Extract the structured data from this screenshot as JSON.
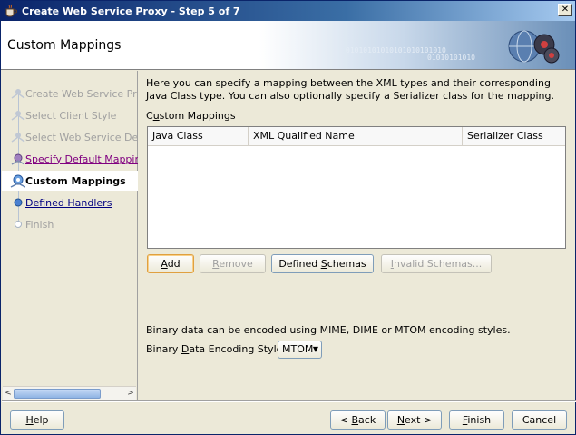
{
  "window": {
    "title": "Create Web Service Proxy - Step 5 of 7",
    "close_glyph": "✕"
  },
  "banner": {
    "title": "Custom Mappings",
    "binary_line1": "01010101010101010101010",
    "binary_line2": "01010101010"
  },
  "nav": {
    "items": [
      {
        "label": "Create Web Service Proxy",
        "state": "disabled",
        "icon": "step-done-icon"
      },
      {
        "label": "Select Client Style",
        "state": "disabled",
        "icon": "step-done-icon"
      },
      {
        "label": "Select Web Service Description",
        "state": "disabled",
        "icon": "step-done-icon"
      },
      {
        "label": "Specify Default Mapping Options",
        "state": "visited",
        "icon": "step-visited-icon"
      },
      {
        "label": "Custom Mappings",
        "state": "current",
        "icon": "step-current-icon"
      },
      {
        "label": "Defined Handlers",
        "state": "link",
        "icon": "step-next-icon"
      },
      {
        "label": "Finish",
        "state": "disabled",
        "icon": "step-pending-icon"
      }
    ],
    "scroll_left": "<",
    "scroll_right": ">"
  },
  "content": {
    "intro": "Here you can specify a mapping between the XML types and their corresponding Java Class type. You can also optionally specify a Serializer class for the mapping.",
    "section_label": "Custom Mappings",
    "table": {
      "columns": [
        "Java Class",
        "XML Qualified Name",
        "Serializer Class"
      ],
      "rows": []
    },
    "buttons": {
      "add": "Add",
      "remove": "Remove",
      "defined_schemas": "Defined Schemas",
      "invalid_schemas": "Invalid Schemas..."
    },
    "binary_text": "Binary data can be encoded using MIME, DIME or MTOM encoding styles.",
    "encoding_label": "Binary Data Encoding Style:",
    "encoding_value": "MTOM"
  },
  "footer": {
    "help": "Help",
    "back": "< Back",
    "next": "Next >",
    "finish": "Finish",
    "cancel": "Cancel"
  }
}
